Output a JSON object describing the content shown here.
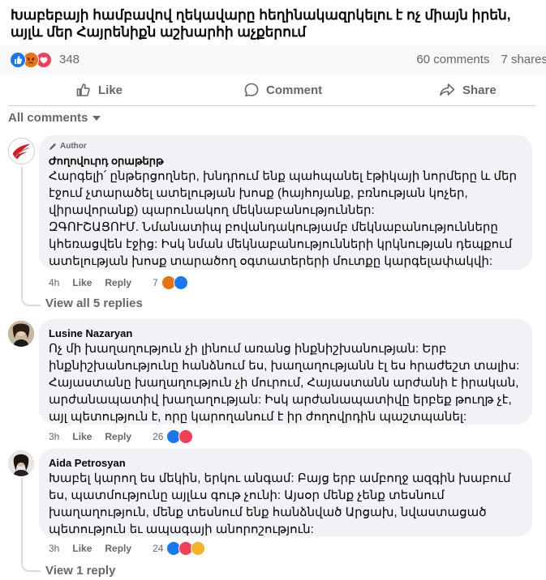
{
  "post": {
    "title": "Խաբեբայի համբավով ղեկավարը հեղինակազրկելու է ոչ միայն իրեն, այլև մեր Հայրենիքն աշխարհի աչքերում"
  },
  "reactions": {
    "count": "348",
    "comments": "60 comments",
    "shares": "7 shares",
    "icons": [
      "like-icon",
      "angry-icon",
      "love-icon"
    ]
  },
  "actions": {
    "like": "Like",
    "comment": "Comment",
    "share": "Share"
  },
  "sort": {
    "label": "All comments"
  },
  "comments": [
    {
      "badge": "Author",
      "author": "Ժողովուրդ օրաթերթ",
      "paragraphs": [
        "Հարգելի՛ ընթերցողներ, խնդրում ենք պահպանել էթիկայի նորմերը և մեր էջում չտարածել ատելության խոսք (հայհոյանք, բռնության կոչեր, վիրավորանք) պարունակող մեկնաբանություններ:",
        "ԶԳՈՒՇԱՑՈՒՄ. Նմանատիպ բովանդակությամբ մեկնաբանությունները կհեռացվեն էջից: Իսկ նման մեկնաբանությունների կրկնության դեպքում ատելության խոսք տարածող օգտատերերի մուտքը կարգելափակվի:"
      ],
      "time": "4h",
      "like": "Like",
      "reply": "Reply",
      "reaction_count": "7",
      "view_replies": "View all 5 replies"
    },
    {
      "author": "Lusine Nazaryan",
      "paragraphs": [
        "Ոչ մի խաղաղություն չի լինում առանց ինքնիշխանության: Երբ ինքնիշխանությունը հանձնում ես, խաղաղությանն էլ ես հրաժեշտ տալիս: Հայաստանը խաղաղություն չի մուրում, Հայաստանն արժանի է իրական, արժանապատիվ խաղաղության: Իսկ արժանապատիվը երբեք թուղթ չէ, այլ պետություն է, որը կարողանում է իր ժողովրդին պաշտպանել:"
      ],
      "time": "3h",
      "like": "Like",
      "reply": "Reply",
      "reaction_count": "26"
    },
    {
      "author": "Aida Petrosyan",
      "paragraphs": [
        "Խաբել կարող ես մեկին, երկու անգամ: Բայց երբ ամբողջ ազգին խաբում ես, պատմությունը այլևս գութ չունի: Այսօր մենք չենք տեսնում խաղաղություն, մենք տեսնում ենք հանձնված Արցախ, նվաստացած պետություն եւ ապագայի անորոշություն:"
      ],
      "time": "3h",
      "like": "Like",
      "reply": "Reply",
      "reaction_count": "24",
      "view_replies": "View 1 reply"
    }
  ],
  "colors": {
    "like": "#1877f2",
    "love": "#f33e58",
    "angry": "#e9710f",
    "haha": "#f7b125",
    "bubble": "#f0f2f5",
    "muted": "#65676b"
  }
}
